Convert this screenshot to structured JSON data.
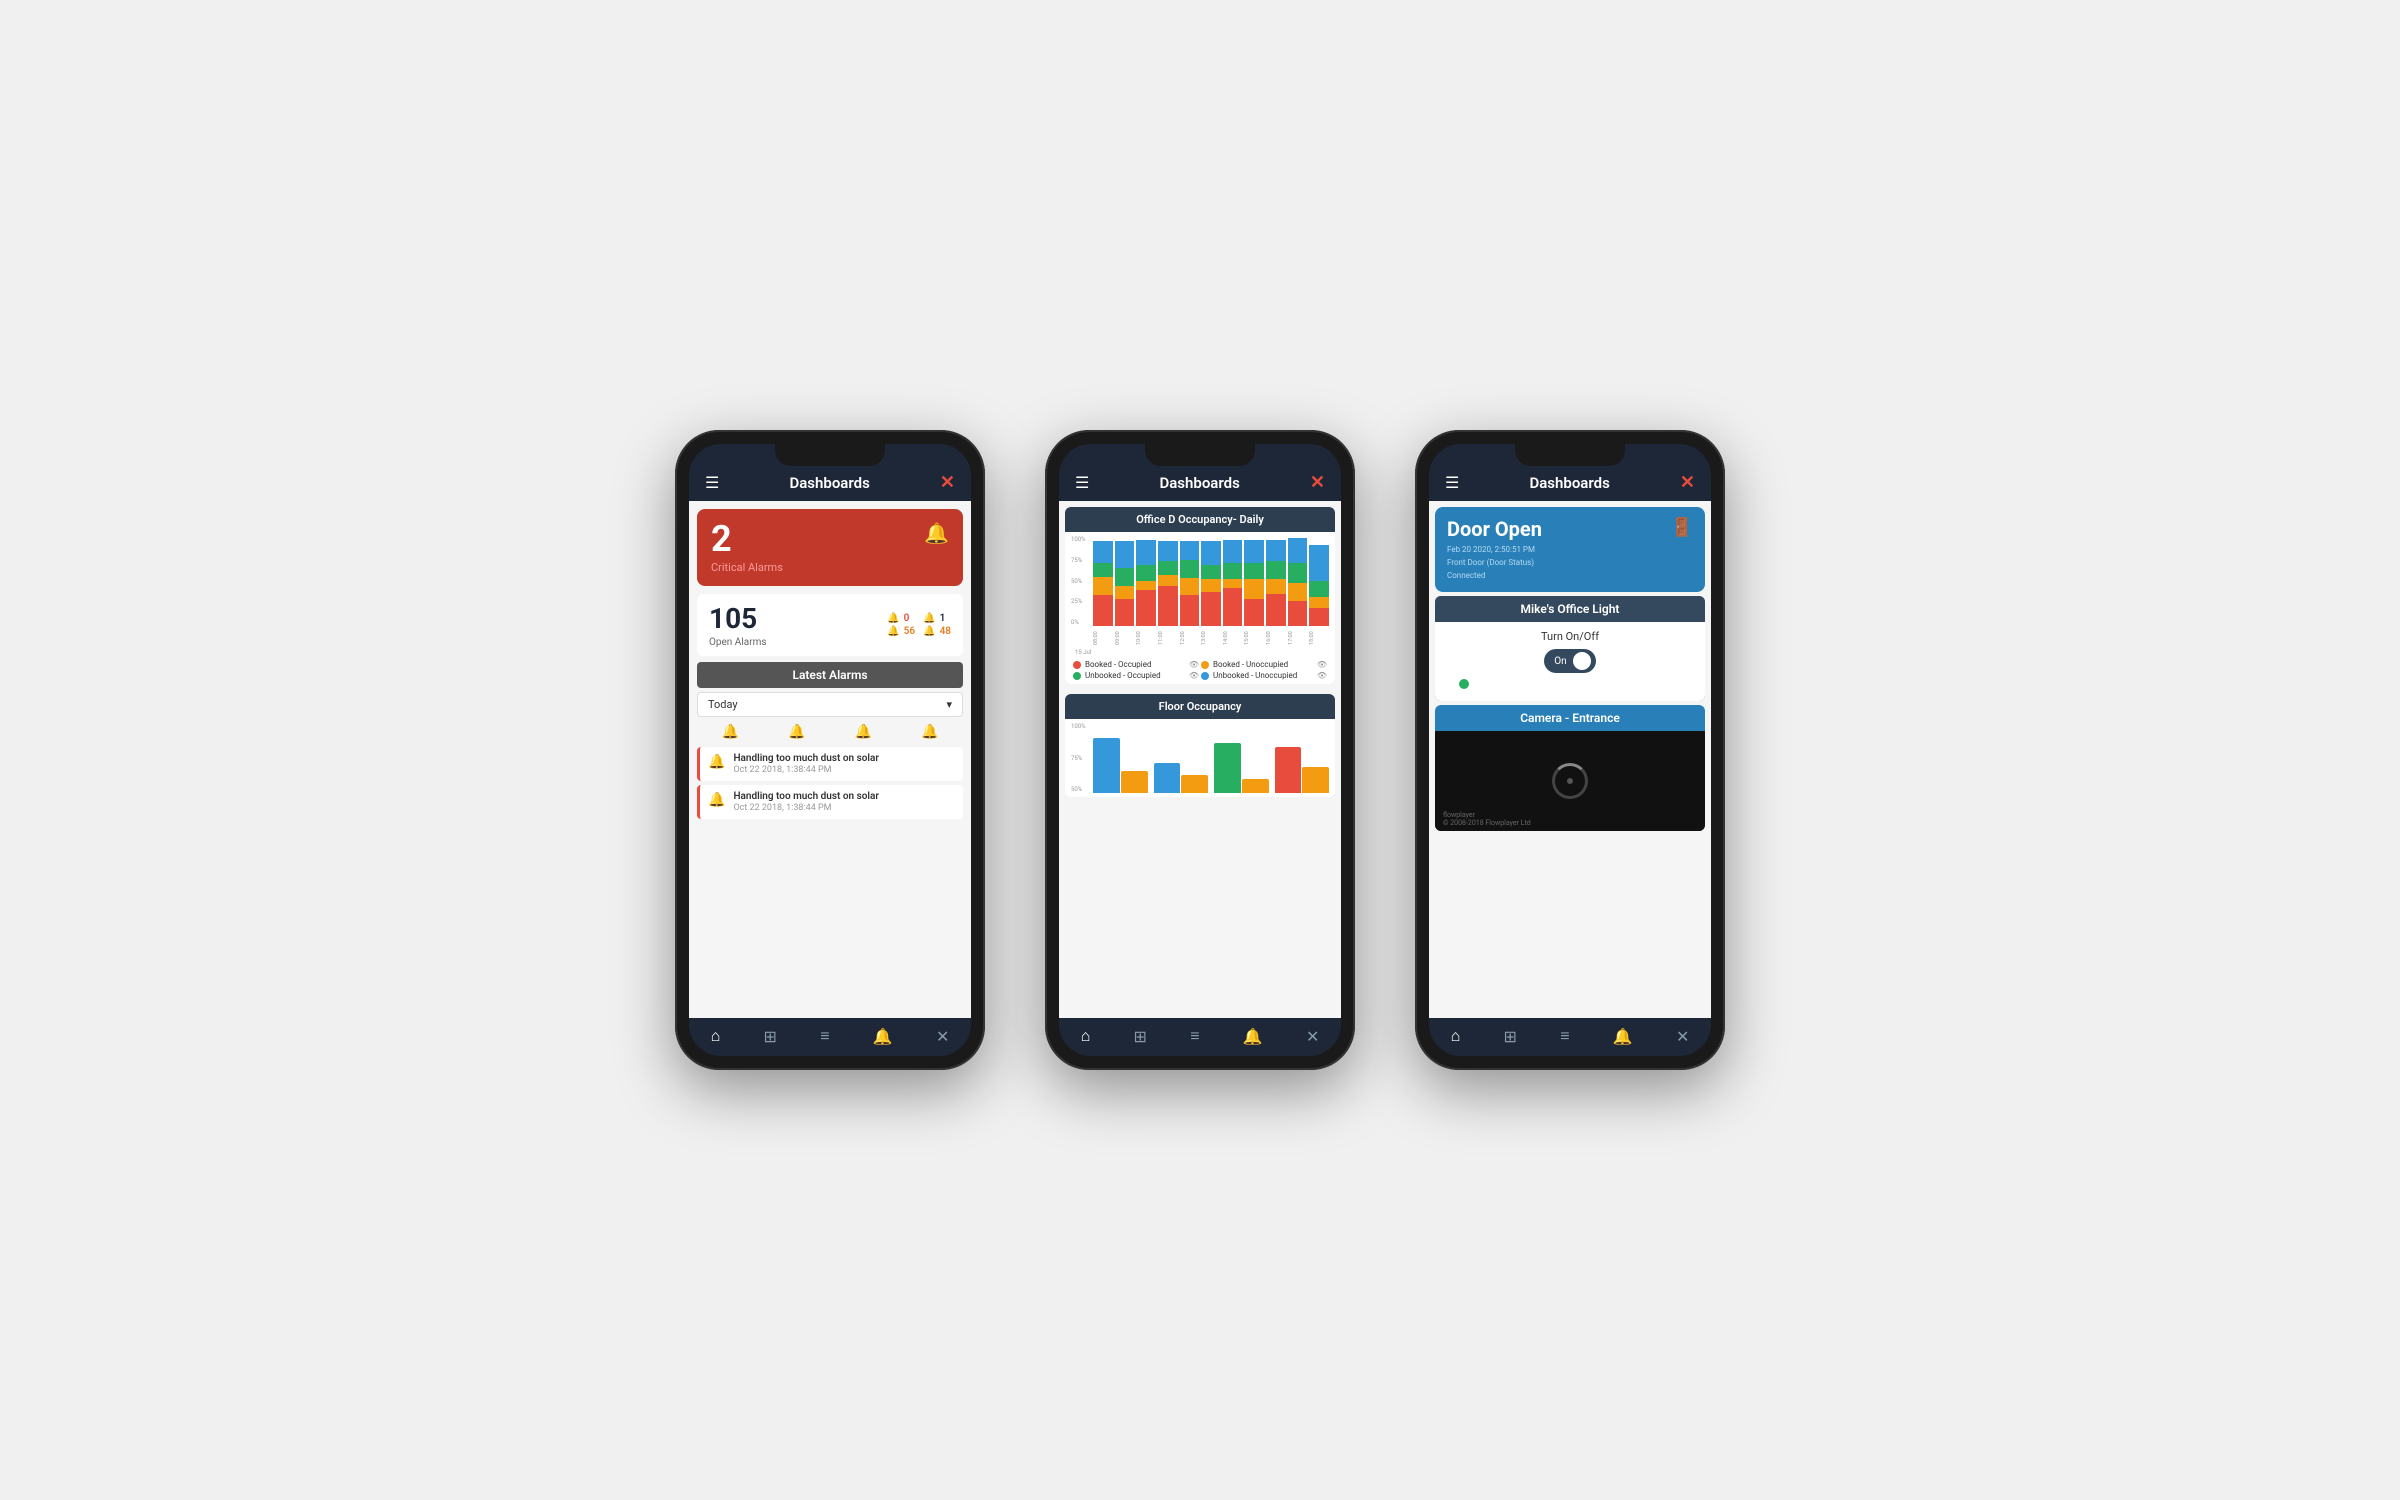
{
  "phones": {
    "header": {
      "title": "Dashboards",
      "menu_icon": "☰",
      "close_icon": "✕"
    },
    "phone1": {
      "critical_alarm_number": "2",
      "critical_alarm_label": "Critical Alarms",
      "open_alarms_number": "105",
      "open_alarms_label": "Open Alarms",
      "stat1_icon": "🔔",
      "stat1_value": "0",
      "stat2_icon": "🔔",
      "stat2_value": "1",
      "stat3_icon": "🔔",
      "stat3_value": "56",
      "stat4_icon": "🔔",
      "stat4_value": "48",
      "latest_alarms_title": "Latest Alarms",
      "dropdown_value": "Today",
      "alarm_items": [
        {
          "title": "Handling too much dust on solar",
          "date": "Oct 22 2018, 1:38:44 PM"
        },
        {
          "title": "Handling too much dust on solar",
          "date": "Oct 22 2018, 1:38:44 PM"
        }
      ]
    },
    "phone2": {
      "chart1_title": "Office D Occupancy- Daily",
      "y_labels": [
        "100%",
        "75%",
        "50%",
        "25%",
        "0%"
      ],
      "x_labels": [
        "08:00",
        "09:00",
        "10:00",
        "11:00",
        "12:00",
        "13:00",
        "14:00",
        "15:00",
        "16:00",
        "17:00",
        "18:00"
      ],
      "legend_items": [
        {
          "label": "Booked - Occupied",
          "color": "#e74c3c"
        },
        {
          "label": "Booked - Unoccupied",
          "color": "#f39c12"
        },
        {
          "label": "Unbooked - Occupied",
          "color": "#27ae60"
        },
        {
          "label": "Unbooked - Unoccupied",
          "color": "#3498db"
        }
      ],
      "chart2_title": "Floor Occupancy",
      "floor_y_labels": [
        "100%",
        "75%",
        "50%"
      ],
      "floor_bars": [
        {
          "colors": [
            "#3498db",
            "#f39c12"
          ],
          "heights": [
            55,
            25
          ]
        },
        {
          "colors": [
            "#3498db",
            "#f39c12"
          ],
          "heights": [
            30,
            20
          ]
        },
        {
          "colors": [
            "#27ae60",
            "#f39c12"
          ],
          "heights": [
            50,
            15
          ]
        },
        {
          "colors": [
            "#e74c3c",
            "#f39c12"
          ],
          "heights": [
            45,
            28
          ]
        }
      ]
    },
    "phone3": {
      "door_status": "Door Open",
      "door_date": "Feb 20 2020, 2:50:51 PM",
      "door_location": "Front Door (Door Status)",
      "door_connection": "Connected",
      "light_title": "Mike's Office Light",
      "turn_on_label": "Turn On/Off",
      "toggle_state": "On",
      "camera_title": "Camera - Entrance",
      "camera_brand": "flowplayer",
      "camera_copyright": "© 2008-2018 Flowplayer Ltd"
    }
  },
  "nav": {
    "home": "⌂",
    "devices": "⊞",
    "menu": "≡",
    "alerts": "🔔",
    "settings": "✕"
  }
}
